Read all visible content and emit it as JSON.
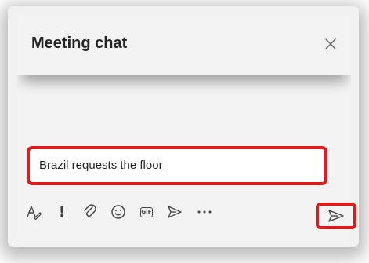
{
  "header": {
    "title": "Meeting chat",
    "close_icon": "close-icon"
  },
  "compose": {
    "value": "Brazil requests the floor",
    "placeholder": ""
  },
  "toolbar": {
    "items": [
      {
        "icon": "format-icon",
        "label": "Format"
      },
      {
        "icon": "important-icon",
        "label": "!"
      },
      {
        "icon": "attach-icon",
        "label": "Attach"
      },
      {
        "icon": "emoji-icon",
        "label": "Emoji"
      },
      {
        "icon": "gif-icon",
        "label": "GIF"
      },
      {
        "icon": "stream-icon",
        "label": "Stream"
      },
      {
        "icon": "more-icon",
        "label": "More options"
      }
    ],
    "gif_label": "GIF",
    "important_label": "!",
    "send_icon": "send-icon"
  },
  "colors": {
    "highlight": "#e01b1b",
    "panel_bg": "#f3f3f3",
    "title_text": "#252423",
    "icon": "#424242"
  }
}
